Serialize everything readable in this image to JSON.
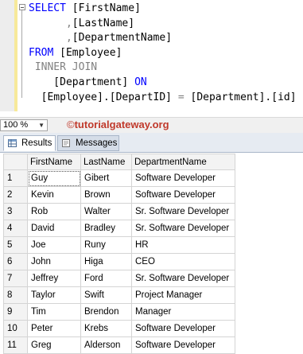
{
  "editor": {
    "lines": [
      {
        "parts": [
          {
            "t": "SELECT ",
            "c": "kw"
          },
          {
            "t": "[FirstName]",
            "c": "bk"
          }
        ]
      },
      {
        "parts": [
          {
            "t": "      ,",
            "c": "gr"
          },
          {
            "t": "[LastName]",
            "c": "bk"
          }
        ]
      },
      {
        "parts": [
          {
            "t": "      ,",
            "c": "gr"
          },
          {
            "t": "[DepartmentName]",
            "c": "bk"
          }
        ]
      },
      {
        "parts": [
          {
            "t": "FROM ",
            "c": "kw"
          },
          {
            "t": "[Employee]",
            "c": "bk"
          }
        ]
      },
      {
        "parts": [
          {
            "t": " INNER JOIN",
            "c": "gr"
          }
        ]
      },
      {
        "parts": [
          {
            "t": "    [Department] ",
            "c": "bk"
          },
          {
            "t": "ON",
            "c": "kw"
          }
        ]
      },
      {
        "parts": [
          {
            "t": "  [Employee].[DepartID] ",
            "c": "bk"
          },
          {
            "t": "=",
            "c": "gr"
          },
          {
            "t": " [Department].[id]",
            "c": "bk"
          }
        ]
      }
    ]
  },
  "zoom": {
    "value": "100 %"
  },
  "watermark": {
    "symbol": "©",
    "text": "tutorialgateway.org"
  },
  "tabs": {
    "results": "Results",
    "messages": "Messages"
  },
  "grid": {
    "columns": [
      "FirstName",
      "LastName",
      "DepartmentName"
    ],
    "rows": [
      [
        "1",
        "Guy",
        "Gibert",
        "Software Developer"
      ],
      [
        "2",
        "Kevin",
        "Brown",
        "Software Developer"
      ],
      [
        "3",
        "Rob",
        "Walter",
        "Sr. Software Developer"
      ],
      [
        "4",
        "David",
        "Bradley",
        "Sr. Software Developer"
      ],
      [
        "5",
        "Joe",
        "Runy",
        "HR"
      ],
      [
        "6",
        "John",
        "Higa",
        "CEO"
      ],
      [
        "7",
        "Jeffrey",
        "Ford",
        "Sr. Software Developer"
      ],
      [
        "8",
        "Taylor",
        "Swift",
        "Project Manager"
      ],
      [
        "9",
        "Tim",
        "Brendon",
        "Manager"
      ],
      [
        "10",
        "Peter",
        "Krebs",
        "Software Developer"
      ],
      [
        "11",
        "Greg",
        "Alderson",
        "Software Developer"
      ]
    ]
  },
  "colors": {
    "keyword": "#0000ff",
    "operator": "#808080",
    "watermark": "#c0392b",
    "change_bar": "#f7e99a"
  }
}
